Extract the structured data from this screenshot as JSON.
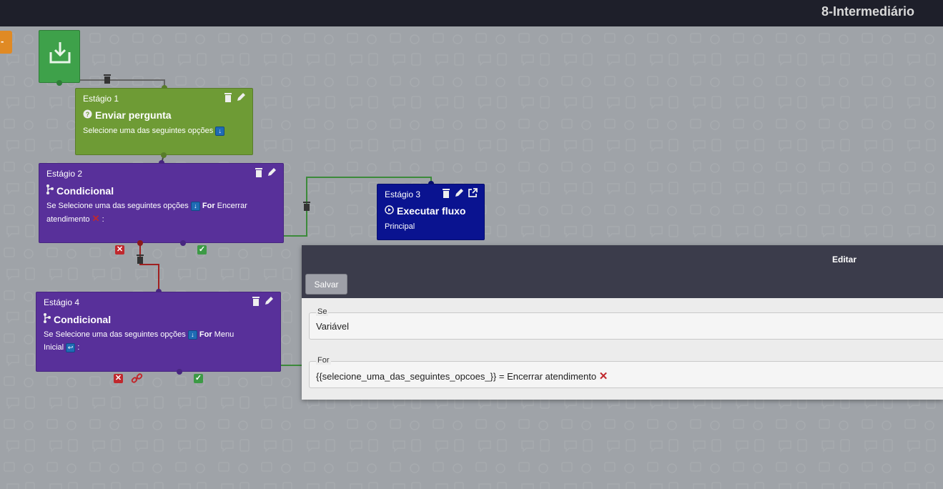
{
  "header": {
    "title": "8-Intermediário"
  },
  "nodes": {
    "stage1": {
      "label": "Estágio 1",
      "title": "Enviar pergunta",
      "text": "Selecione uma das seguintes opções"
    },
    "stage2": {
      "label": "Estágio 2",
      "title": "Condicional",
      "text_a": "Se Selecione uma das seguintes opções",
      "for_word": "For",
      "text_b": "Encerrar",
      "text_c": "atendimento",
      "colon": ":"
    },
    "stage3": {
      "label": "Estágio 3",
      "title": "Executar fluxo",
      "text": "Principal"
    },
    "stage4": {
      "label": "Estágio 4",
      "title": "Condicional",
      "text_a": "Se Selecione uma das seguintes opções",
      "for_word": "For",
      "text_b": "Menu",
      "text_c": "Inicial",
      "colon": ":"
    }
  },
  "editor": {
    "title": "Editar",
    "save_label": "Salvar",
    "fields": [
      {
        "legend": "Se",
        "value": "Variável"
      },
      {
        "legend": "For",
        "value": "{{selecione_uma_das_seguintes_opcoes_}} = Encerrar atendimento"
      }
    ]
  },
  "icons": {
    "start": "download-icon",
    "question": "question-circle-icon",
    "branch": "branch-icon",
    "play": "play-circle-icon",
    "trash": "trash-icon",
    "pencil": "pencil-icon",
    "external": "external-link-icon",
    "link": "link-icon"
  },
  "colors": {
    "topbar": "#1e1f2a",
    "stage_green": "#6e9b35",
    "stage_purple": "#58309a",
    "stage_blue": "#0a1390",
    "start_green": "#3ea14a",
    "editor_header": "#3b3c4b"
  }
}
